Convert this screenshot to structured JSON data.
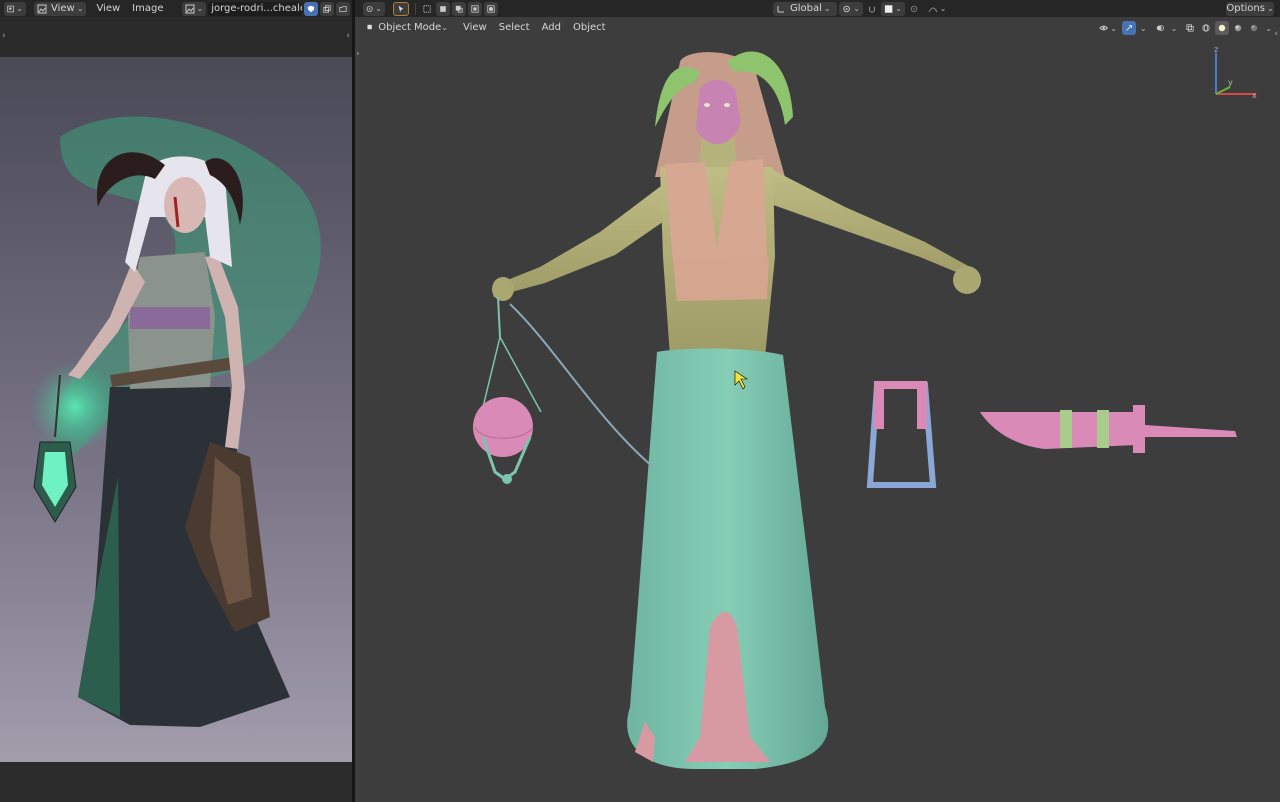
{
  "image_editor": {
    "view_menu": "View",
    "menus": [
      "View",
      "Image"
    ],
    "image_name": "jorge-rodri...chealer.jpg"
  },
  "viewport": {
    "transform_orientation": "Global",
    "options": "Options",
    "mode": "Object Mode",
    "menus": [
      "View",
      "Select",
      "Add",
      "Object"
    ],
    "gizmo_z": "z",
    "gizmo_y": "y",
    "gizmo_x": "x"
  },
  "colors": {
    "header_bg": "#262626",
    "viewport_bg": "#3d3d3d",
    "active_button": "#4772b3",
    "skirt": "#7cc4ae",
    "skin": "#b3b07a",
    "top": "#d4a68e",
    "pink": "#d98ab6"
  }
}
